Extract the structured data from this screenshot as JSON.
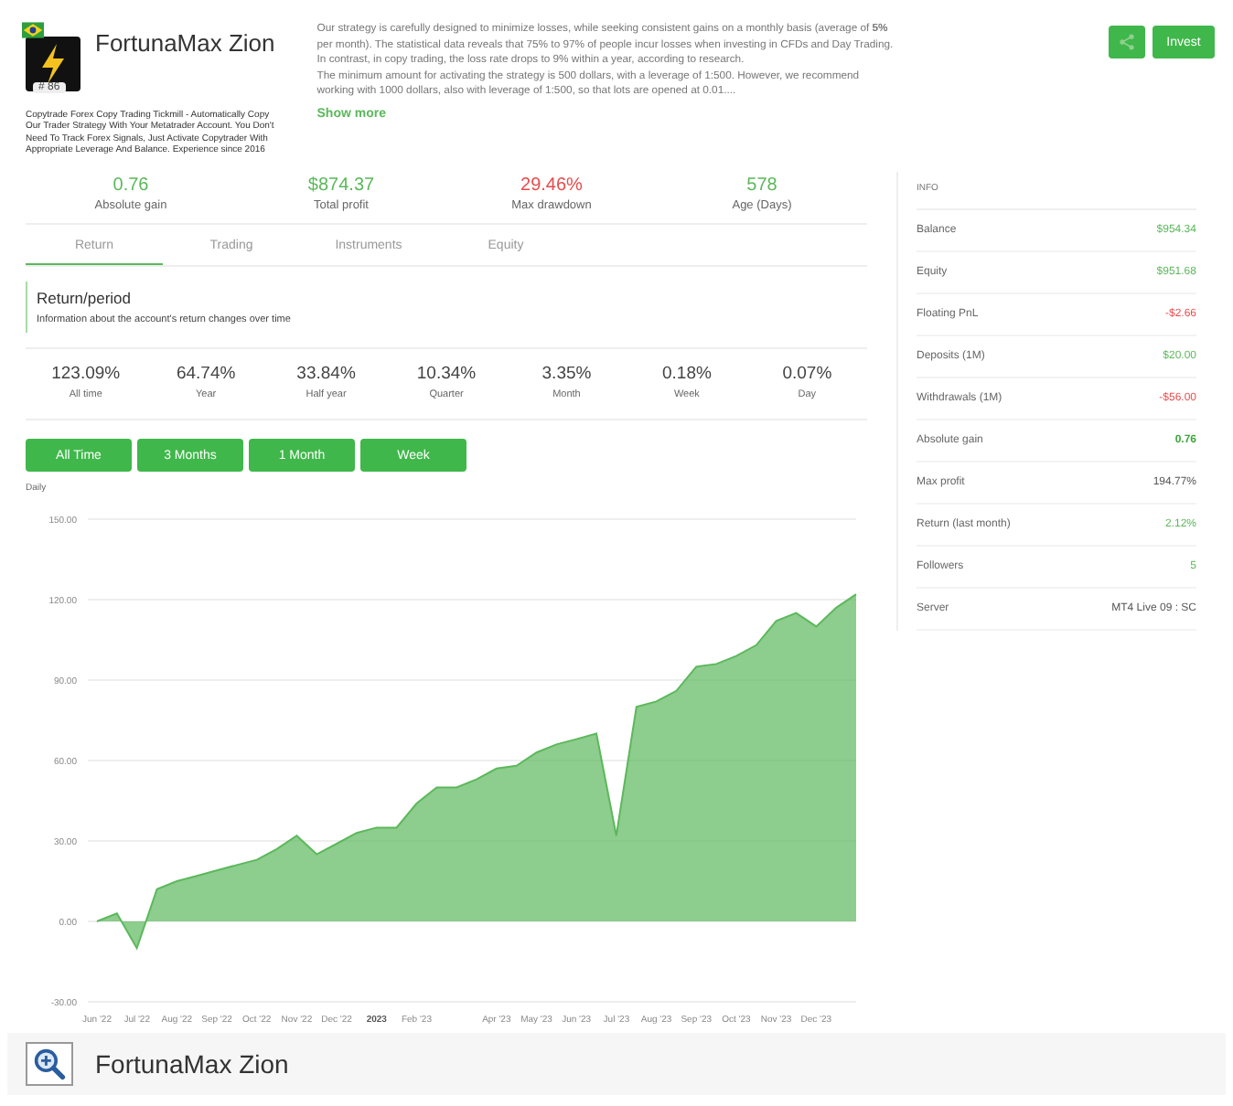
{
  "profile": {
    "name": "FortunaMax Zion",
    "rank": "# 86",
    "description": "Copytrade Forex Copy Trading Tickmill - Automatically Copy Our Trader Strategy With Your Metatrader Account. You Don't Need To Track Forex Signals, Just Activate Copytrader With Appropriate Leverage And Balance. Experience since 2016"
  },
  "strategy": {
    "text": "Our strategy is carefully designed to minimize losses, while seeking consistent gains on a monthly basis (average of **5%** per month). The statistical data reveals that 75% to 97% of people incur losses when investing in CFDs and Day Trading. In contrast, in copy trading, the loss rate drops to 9% within a year, according to research.",
    "text2": "The minimum amount for activating the strategy is 500 dollars, with a leverage of 1:500. However, we recommend working with 1000 dollars, also with leverage of 1:500, so that lots are opened at 0.01....",
    "more": "Show more"
  },
  "buttons": {
    "invest": "Invest"
  },
  "summary": [
    {
      "value": "0.76",
      "label": "Absolute gain",
      "color": "#5cb85c"
    },
    {
      "value": "$874.37",
      "label": "Total profit",
      "color": "#5cb85c"
    },
    {
      "value": "29.46%",
      "label": "Max drawdown",
      "color": "#e74c4c"
    },
    {
      "value": "578",
      "label": "Age (Days)",
      "color": "#5cb85c"
    }
  ],
  "tabs": [
    {
      "label": "Return",
      "selected": true
    },
    {
      "label": "Trading",
      "selected": false
    },
    {
      "label": "Instruments",
      "selected": false
    },
    {
      "label": "Equity",
      "selected": false
    }
  ],
  "section": {
    "title": "Return/period",
    "subtitle": "Information about the account's return changes over time"
  },
  "periods": [
    {
      "value": "123.09%",
      "label": "All time"
    },
    {
      "value": "64.74%",
      "label": "Year"
    },
    {
      "value": "33.84%",
      "label": "Half year"
    },
    {
      "value": "10.34%",
      "label": "Quarter"
    },
    {
      "value": "3.35%",
      "label": "Month"
    },
    {
      "value": "0.18%",
      "label": "Week"
    },
    {
      "value": "0.07%",
      "label": "Day"
    }
  ],
  "range_buttons": [
    "All Time",
    "3 Months",
    "1 Month",
    "Week"
  ],
  "chart": {
    "chart_data": {
      "type": "area",
      "categories": [
        "Jun '22",
        null,
        "Jul '22",
        null,
        "Aug '22",
        null,
        "Sep '22",
        null,
        "Oct '22",
        null,
        "Nov '22",
        null,
        "Dec '22",
        null,
        "2023",
        null,
        "Feb '23",
        null,
        null,
        null,
        "Apr '23",
        null,
        "May '23",
        null,
        "Jun '23",
        null,
        "Jul '23",
        null,
        "Aug '23",
        null,
        "Sep '23",
        null,
        "Oct '23",
        null,
        "Nov '23",
        null,
        "Dec '23",
        null,
        null
      ],
      "series": [
        {
          "name": "Daily",
          "color": "#5cb85c",
          "values": [
            0,
            3,
            -10,
            12,
            15,
            17,
            19,
            21,
            23,
            27,
            32,
            25,
            29,
            33,
            35,
            35,
            44,
            50,
            50,
            53,
            57,
            58,
            63,
            66,
            68,
            70,
            32,
            80,
            82,
            86,
            95,
            96,
            99,
            103,
            112,
            115,
            110,
            117,
            122
          ]
        }
      ],
      "ylim": [
        -30,
        150
      ],
      "grid": true,
      "yticks": [
        {
          "value": 150,
          "label": "150.00"
        },
        {
          "value": 120,
          "label": "120.00"
        },
        {
          "value": 90,
          "label": "90.00"
        },
        {
          "value": 60,
          "label": "60.00"
        },
        {
          "value": 30,
          "label": "30.00"
        },
        {
          "value": 0,
          "label": "0.00"
        },
        {
          "value": -30,
          "label": "-30.00"
        }
      ]
    }
  },
  "info": {
    "title": "INFO",
    "rows": [
      {
        "label": "Balance",
        "value": "$954.34",
        "color": "#5cb85c"
      },
      {
        "label": "Equity",
        "value": "$951.68",
        "color": "#5cb85c"
      },
      {
        "label": "Floating PnL",
        "value": "-$2.66",
        "color": "#e74c4c"
      },
      {
        "label": "Deposits (1M)",
        "value": "$20.00",
        "color": "#5cb85c"
      },
      {
        "label": "Withdrawals (1M)",
        "value": "-$56.00",
        "color": "#e74c4c"
      },
      {
        "label": "Absolute gain",
        "value": "0.76",
        "color": "#3aa63a"
      },
      {
        "label": "Max profit",
        "value": "194.77%",
        "color": "#555555"
      },
      {
        "label": "Return (last month)",
        "value": "2.12%",
        "color": "#5cb85c"
      },
      {
        "label": "Followers",
        "value": "5",
        "color": "#5cb85c"
      },
      {
        "label": "Server",
        "value": "MT4 Live 09 : SC",
        "color": "#555555"
      }
    ]
  },
  "caption_bar": {
    "title": "FortunaMax Zion"
  }
}
